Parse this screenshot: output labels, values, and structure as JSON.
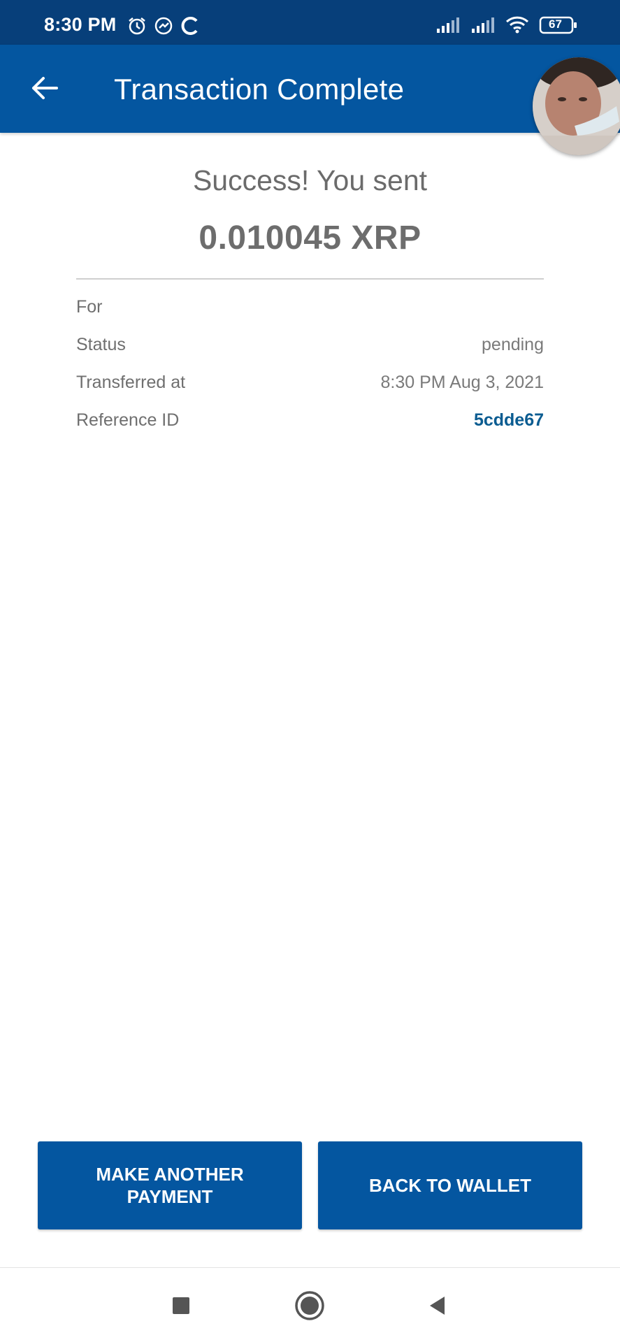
{
  "status_bar": {
    "time": "8:30 PM",
    "battery": "67",
    "icons": [
      "alarm-icon",
      "messenger-icon",
      "c-app-icon",
      "signal-icon",
      "signal-icon",
      "wifi-icon",
      "battery-icon"
    ]
  },
  "app_bar": {
    "title": "Transaction Complete",
    "back_icon": "arrow-left-icon",
    "color": "#0456a0"
  },
  "summary": {
    "success_text": "Success! You sent",
    "amount": "0.010045 XRP"
  },
  "details": [
    {
      "label": "For",
      "value": ""
    },
    {
      "label": "Status",
      "value": "pending"
    },
    {
      "label": "Transferred at",
      "value": "8:30 PM Aug 3, 2021"
    },
    {
      "label": "Reference ID",
      "value": "5cdde67"
    }
  ],
  "actions": {
    "make_another_payment": "MAKE ANOTHER PAYMENT",
    "back_to_wallet": "BACK TO WALLET"
  },
  "nav": {
    "icons": [
      "square-recents-icon",
      "circle-home-icon",
      "triangle-back-icon"
    ]
  },
  "colors": {
    "status_bar": "#073f7a",
    "primary": "#0456a0",
    "link": "#0b5c91",
    "text_gray": "#6f6f6f"
  }
}
